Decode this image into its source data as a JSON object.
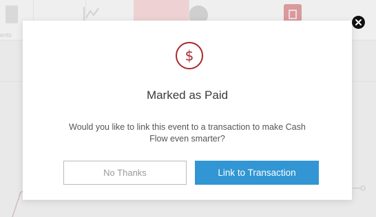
{
  "background": {
    "tab1_label": "ents",
    "icons": [
      "document-icon",
      "line-chart-icon",
      "alert-icon",
      "calendar-icon"
    ]
  },
  "modal": {
    "icon_symbol": "$",
    "title": "Marked as Paid",
    "body": "Would you like to link this event to a transaction to make Cash Flow even smarter?",
    "secondary_button": "No Thanks",
    "primary_button": "Link to Transaction",
    "close_icon": "close-icon"
  },
  "colors": {
    "accent_red": "#a6282b",
    "primary_blue": "#3196d3",
    "close_black": "#111111"
  }
}
